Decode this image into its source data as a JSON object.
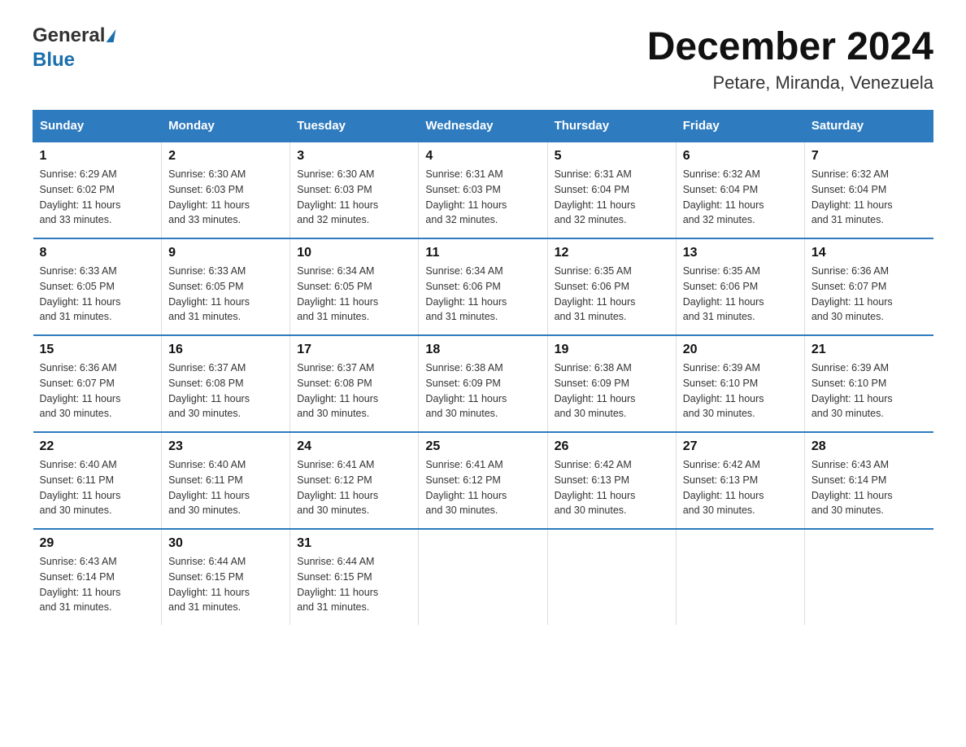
{
  "header": {
    "logo_line1": "General",
    "logo_triangle": "▶",
    "logo_line2": "Blue",
    "title": "December 2024",
    "subtitle": "Petare, Miranda, Venezuela"
  },
  "calendar": {
    "headers": [
      "Sunday",
      "Monday",
      "Tuesday",
      "Wednesday",
      "Thursday",
      "Friday",
      "Saturday"
    ],
    "weeks": [
      [
        {
          "day": "1",
          "sunrise": "6:29 AM",
          "sunset": "6:02 PM",
          "daylight": "11 hours and 33 minutes."
        },
        {
          "day": "2",
          "sunrise": "6:30 AM",
          "sunset": "6:03 PM",
          "daylight": "11 hours and 33 minutes."
        },
        {
          "day": "3",
          "sunrise": "6:30 AM",
          "sunset": "6:03 PM",
          "daylight": "11 hours and 32 minutes."
        },
        {
          "day": "4",
          "sunrise": "6:31 AM",
          "sunset": "6:03 PM",
          "daylight": "11 hours and 32 minutes."
        },
        {
          "day": "5",
          "sunrise": "6:31 AM",
          "sunset": "6:04 PM",
          "daylight": "11 hours and 32 minutes."
        },
        {
          "day": "6",
          "sunrise": "6:32 AM",
          "sunset": "6:04 PM",
          "daylight": "11 hours and 32 minutes."
        },
        {
          "day": "7",
          "sunrise": "6:32 AM",
          "sunset": "6:04 PM",
          "daylight": "11 hours and 31 minutes."
        }
      ],
      [
        {
          "day": "8",
          "sunrise": "6:33 AM",
          "sunset": "6:05 PM",
          "daylight": "11 hours and 31 minutes."
        },
        {
          "day": "9",
          "sunrise": "6:33 AM",
          "sunset": "6:05 PM",
          "daylight": "11 hours and 31 minutes."
        },
        {
          "day": "10",
          "sunrise": "6:34 AM",
          "sunset": "6:05 PM",
          "daylight": "11 hours and 31 minutes."
        },
        {
          "day": "11",
          "sunrise": "6:34 AM",
          "sunset": "6:06 PM",
          "daylight": "11 hours and 31 minutes."
        },
        {
          "day": "12",
          "sunrise": "6:35 AM",
          "sunset": "6:06 PM",
          "daylight": "11 hours and 31 minutes."
        },
        {
          "day": "13",
          "sunrise": "6:35 AM",
          "sunset": "6:06 PM",
          "daylight": "11 hours and 31 minutes."
        },
        {
          "day": "14",
          "sunrise": "6:36 AM",
          "sunset": "6:07 PM",
          "daylight": "11 hours and 30 minutes."
        }
      ],
      [
        {
          "day": "15",
          "sunrise": "6:36 AM",
          "sunset": "6:07 PM",
          "daylight": "11 hours and 30 minutes."
        },
        {
          "day": "16",
          "sunrise": "6:37 AM",
          "sunset": "6:08 PM",
          "daylight": "11 hours and 30 minutes."
        },
        {
          "day": "17",
          "sunrise": "6:37 AM",
          "sunset": "6:08 PM",
          "daylight": "11 hours and 30 minutes."
        },
        {
          "day": "18",
          "sunrise": "6:38 AM",
          "sunset": "6:09 PM",
          "daylight": "11 hours and 30 minutes."
        },
        {
          "day": "19",
          "sunrise": "6:38 AM",
          "sunset": "6:09 PM",
          "daylight": "11 hours and 30 minutes."
        },
        {
          "day": "20",
          "sunrise": "6:39 AM",
          "sunset": "6:10 PM",
          "daylight": "11 hours and 30 minutes."
        },
        {
          "day": "21",
          "sunrise": "6:39 AM",
          "sunset": "6:10 PM",
          "daylight": "11 hours and 30 minutes."
        }
      ],
      [
        {
          "day": "22",
          "sunrise": "6:40 AM",
          "sunset": "6:11 PM",
          "daylight": "11 hours and 30 minutes."
        },
        {
          "day": "23",
          "sunrise": "6:40 AM",
          "sunset": "6:11 PM",
          "daylight": "11 hours and 30 minutes."
        },
        {
          "day": "24",
          "sunrise": "6:41 AM",
          "sunset": "6:12 PM",
          "daylight": "11 hours and 30 minutes."
        },
        {
          "day": "25",
          "sunrise": "6:41 AM",
          "sunset": "6:12 PM",
          "daylight": "11 hours and 30 minutes."
        },
        {
          "day": "26",
          "sunrise": "6:42 AM",
          "sunset": "6:13 PM",
          "daylight": "11 hours and 30 minutes."
        },
        {
          "day": "27",
          "sunrise": "6:42 AM",
          "sunset": "6:13 PM",
          "daylight": "11 hours and 30 minutes."
        },
        {
          "day": "28",
          "sunrise": "6:43 AM",
          "sunset": "6:14 PM",
          "daylight": "11 hours and 30 minutes."
        }
      ],
      [
        {
          "day": "29",
          "sunrise": "6:43 AM",
          "sunset": "6:14 PM",
          "daylight": "11 hours and 31 minutes."
        },
        {
          "day": "30",
          "sunrise": "6:44 AM",
          "sunset": "6:15 PM",
          "daylight": "11 hours and 31 minutes."
        },
        {
          "day": "31",
          "sunrise": "6:44 AM",
          "sunset": "6:15 PM",
          "daylight": "11 hours and 31 minutes."
        },
        null,
        null,
        null,
        null
      ]
    ]
  },
  "labels": {
    "sunrise": "Sunrise:",
    "sunset": "Sunset:",
    "daylight": "Daylight:"
  }
}
